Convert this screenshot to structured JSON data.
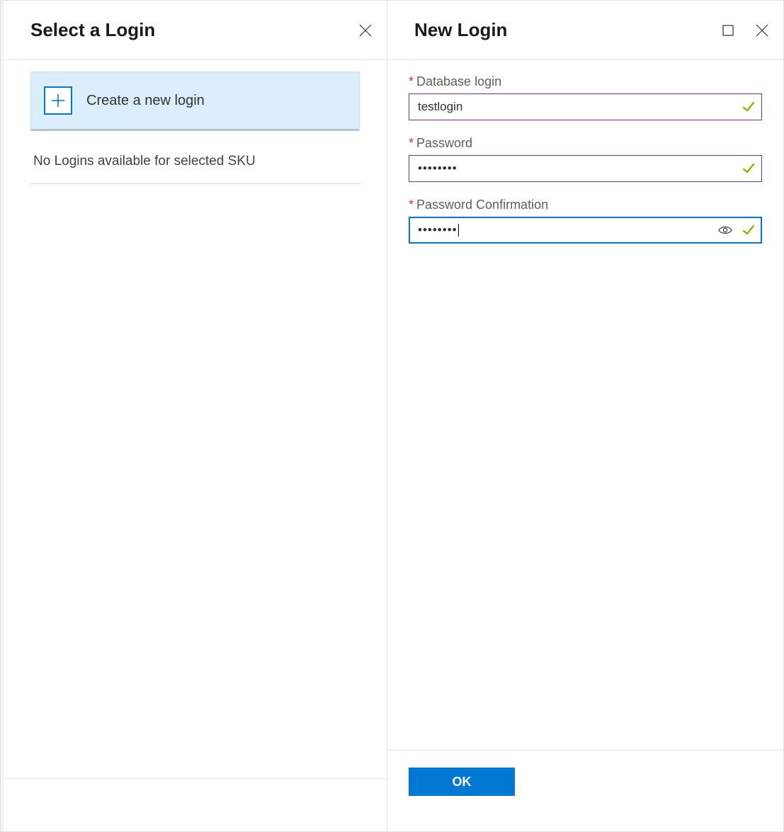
{
  "left": {
    "title": "Select a Login",
    "create_label": "Create a new login",
    "empty_text": "No Logins available for selected SKU"
  },
  "right": {
    "title": "New Login",
    "fields": {
      "login_label": "Database login",
      "login_value": "testlogin",
      "password_label": "Password",
      "password_value": "••••••••",
      "confirm_label": "Password Confirmation",
      "confirm_value": "••••••••"
    },
    "ok_label": "OK"
  }
}
